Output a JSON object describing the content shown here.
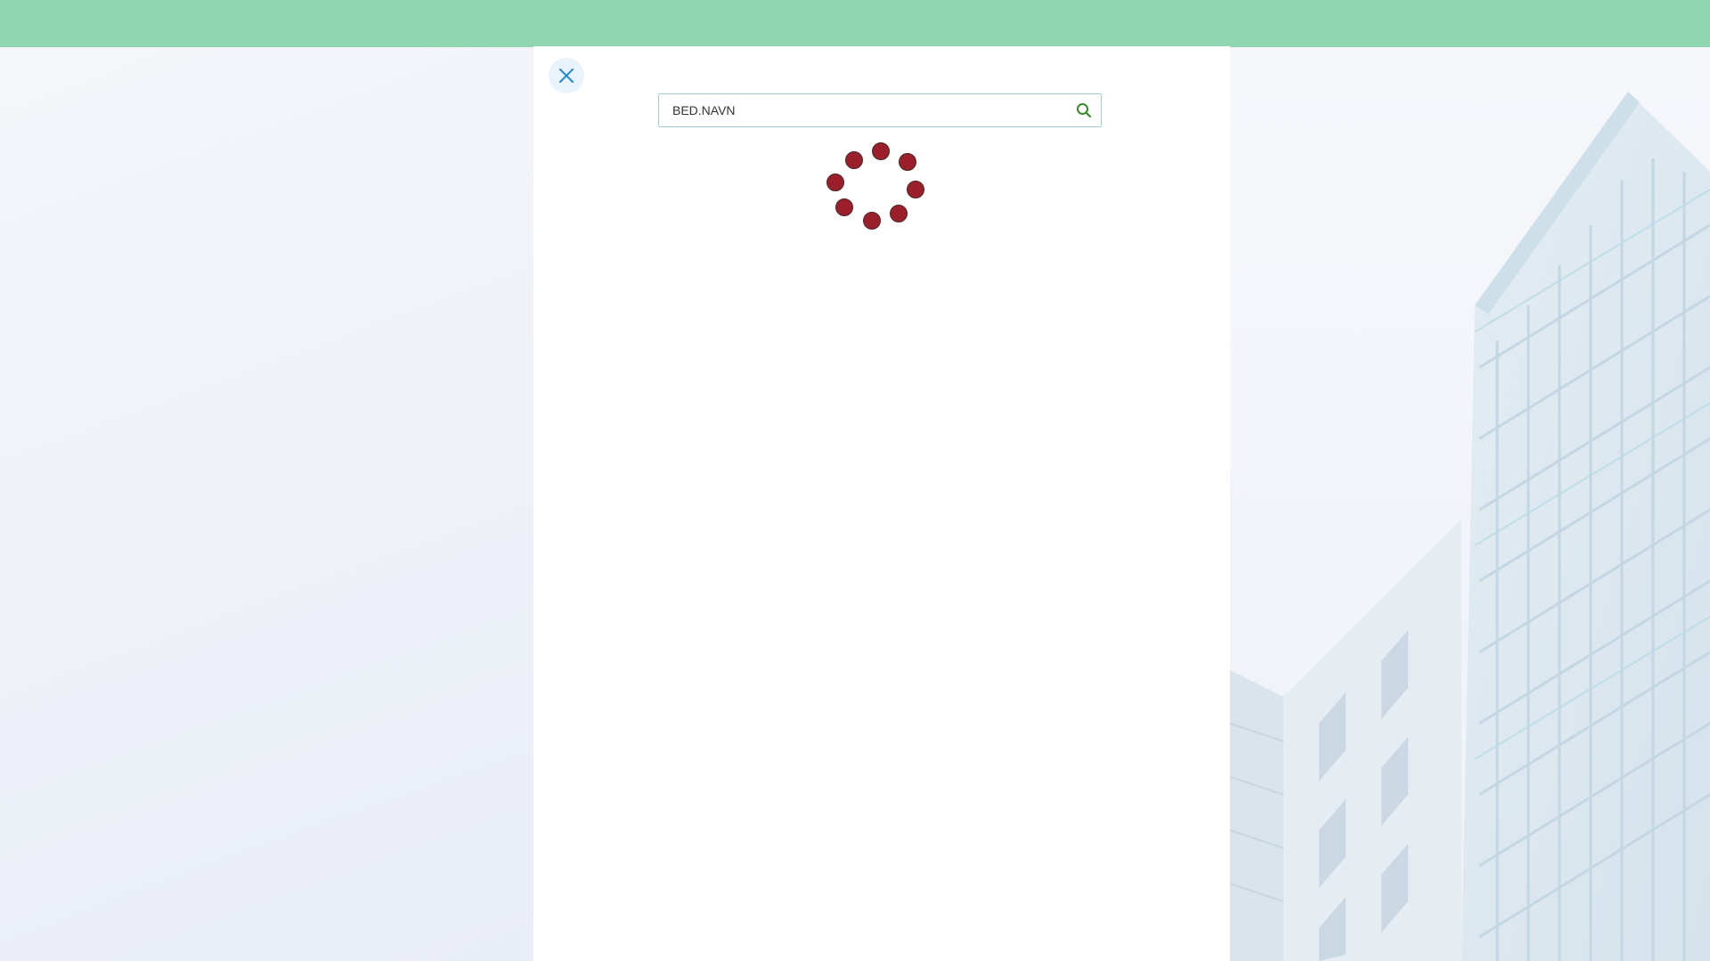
{
  "header": {
    "color": "#90d6b0"
  },
  "dialog": {
    "close_icon": "close-icon",
    "search": {
      "value": "BED.NAVN",
      "placeholder": "",
      "icon": "search-icon"
    },
    "loading": {
      "icon": "loading-spinner",
      "dot_color": "#9b1f2b"
    }
  },
  "colors": {
    "accent": "#1e88d6",
    "search_icon": "#3a8a2a",
    "page_background": "#f3f5fa"
  }
}
